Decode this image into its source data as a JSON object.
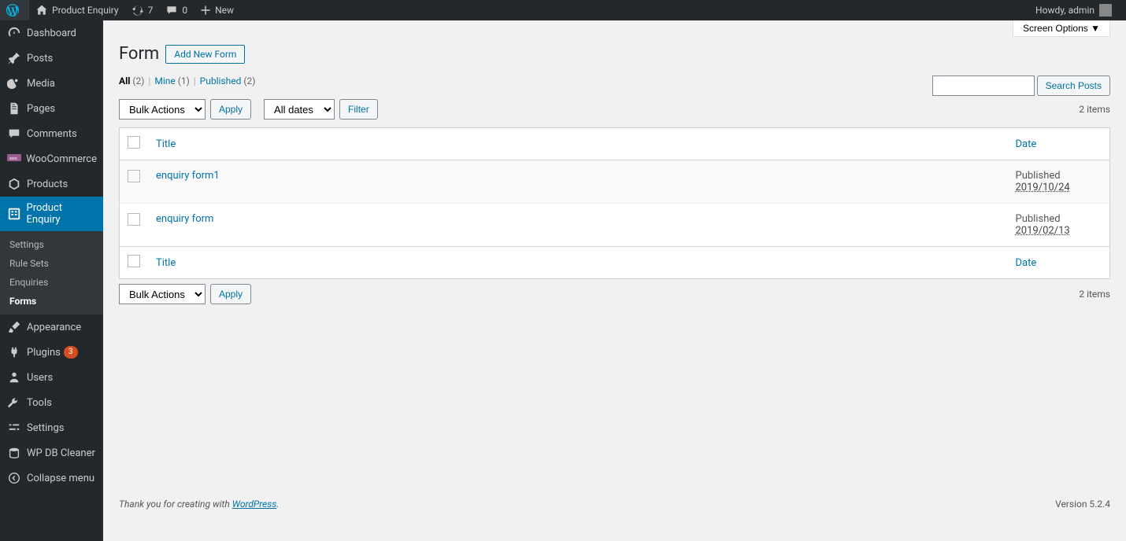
{
  "topbar": {
    "site_name": "Product Enquiry",
    "updates_count": "7",
    "comments_count": "0",
    "new_label": "New",
    "howdy": "Howdy, admin"
  },
  "sidebar": {
    "items": [
      {
        "icon": "speedometer",
        "label": "Dashboard"
      },
      {
        "icon": "pin",
        "label": "Posts"
      },
      {
        "icon": "media",
        "label": "Media"
      },
      {
        "icon": "page",
        "label": "Pages"
      },
      {
        "icon": "comment",
        "label": "Comments"
      },
      {
        "icon": "woo",
        "label": "WooCommerce"
      },
      {
        "icon": "product",
        "label": "Products"
      },
      {
        "icon": "enquiry",
        "label": "Product Enquiry",
        "current": true
      },
      {
        "icon": "brush",
        "label": "Appearance"
      },
      {
        "icon": "plug",
        "label": "Plugins",
        "badge": "3"
      },
      {
        "icon": "user",
        "label": "Users"
      },
      {
        "icon": "wrench",
        "label": "Tools"
      },
      {
        "icon": "slider",
        "label": "Settings"
      },
      {
        "icon": "db",
        "label": "WP DB Cleaner"
      },
      {
        "icon": "collapse",
        "label": "Collapse menu"
      }
    ],
    "submenu": [
      {
        "label": "Settings"
      },
      {
        "label": "Rule Sets"
      },
      {
        "label": "Enquiries"
      },
      {
        "label": "Forms",
        "active": true
      }
    ]
  },
  "screen_options": "Screen Options",
  "page": {
    "title": "Form",
    "action": "Add New Form"
  },
  "filters": {
    "all": "All",
    "all_count": "(2)",
    "mine": "Mine",
    "mine_count": "(1)",
    "published": "Published",
    "published_count": "(2)"
  },
  "search": {
    "button": "Search Posts"
  },
  "bulk": {
    "label": "Bulk Actions",
    "apply": "Apply",
    "dates": "All dates",
    "filter": "Filter"
  },
  "items_count": "2 items",
  "columns": {
    "title": "Title",
    "date": "Date"
  },
  "rows": [
    {
      "title": "enquiry form1",
      "status": "Published",
      "date": "2019/10/24"
    },
    {
      "title": "enquiry form",
      "status": "Published",
      "date": "2019/02/13"
    }
  ],
  "footer": {
    "thank": "Thank you for creating with ",
    "link": "WordPress",
    "period": ".",
    "version": "Version 5.2.4"
  }
}
